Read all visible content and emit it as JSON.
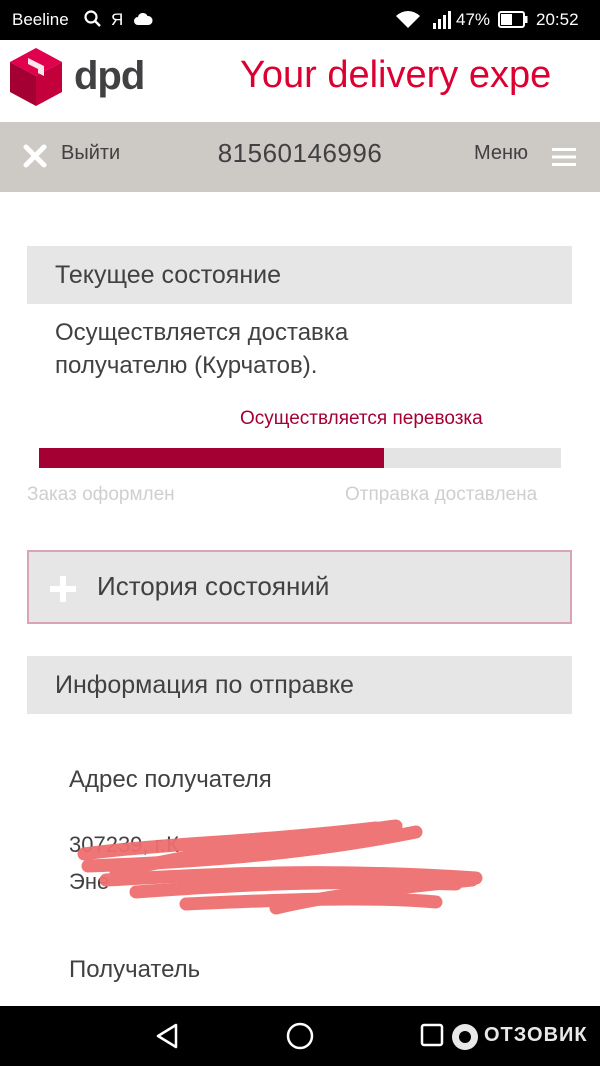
{
  "status_bar": {
    "carrier": "Beeline",
    "yandex_glyph": "Я",
    "battery": "47%",
    "time": "20:52"
  },
  "header": {
    "brand": "dpd",
    "slogan": "Your delivery expe",
    "brand_color": "#dc0032"
  },
  "nav": {
    "exit_label": "Выйти",
    "tracking_number": "81560146996",
    "menu_label": "Меню"
  },
  "current_status": {
    "title": "Текущее состояние",
    "description_line1": "Осуществляется доставка",
    "description_line2": "получателю (Курчатов).",
    "progress_label": "Осуществляется перевозка",
    "progress_fraction": 0.66,
    "step_start": "Заказ оформлен",
    "step_end": "Отправка доставлена"
  },
  "history": {
    "title": "История состояний"
  },
  "shipment_info": {
    "title": "Информация по отправке",
    "recipient_address_title": "Адрес получателя",
    "address_line1": "307239, г.К",
    "address_line2": "Эне",
    "recipient_title": "Получатель"
  },
  "watermark": {
    "text": "ОТЗОВИК"
  },
  "colors": {
    "accent": "#a50034",
    "section_bg": "#e6e6e6",
    "nav_bg": "#cdc9c4",
    "redaction": "#ef6f6f"
  }
}
